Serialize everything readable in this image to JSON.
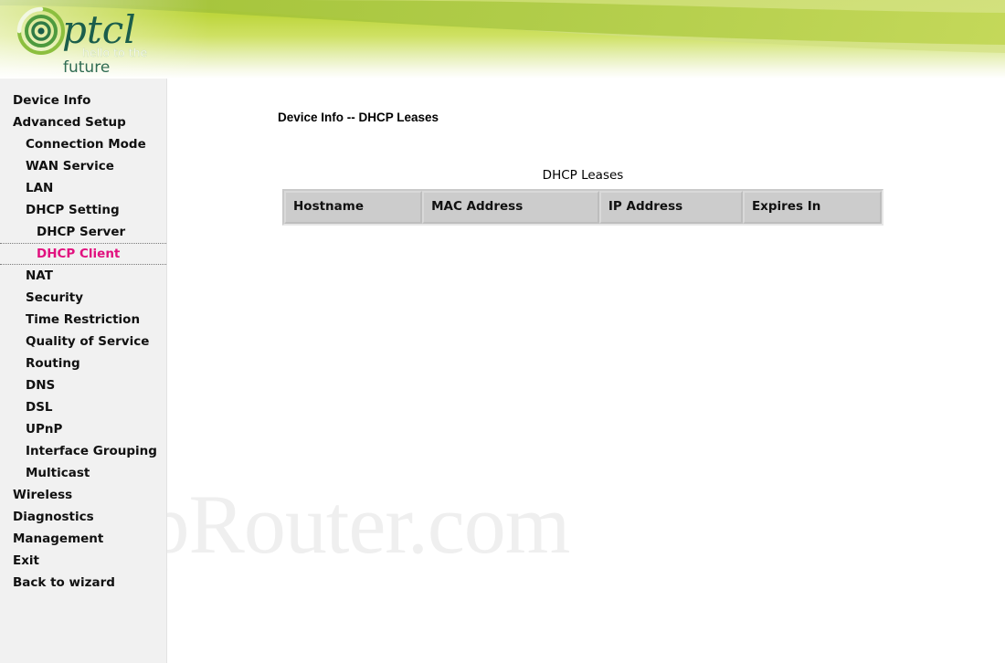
{
  "header": {
    "logo": {
      "brand": "ptcl",
      "tagline_line1": "hello to the",
      "tagline_line2": "future",
      "brand_color": "#1b5e4b",
      "tagline_color": "#ffffff",
      "future_color": "#2f6b52",
      "banner_top_color": "#b9d334",
      "banner_bottom_color": "#ffffff",
      "swoosh_color": "#a4c43a"
    }
  },
  "sidebar": {
    "items": [
      {
        "label": "Device Info",
        "level": 0,
        "selected": false
      },
      {
        "label": "Advanced Setup",
        "level": 0,
        "selected": false
      },
      {
        "label": "Connection Mode",
        "level": 1,
        "selected": false
      },
      {
        "label": "WAN Service",
        "level": 1,
        "selected": false
      },
      {
        "label": "LAN",
        "level": 1,
        "selected": false
      },
      {
        "label": "DHCP Setting",
        "level": 1,
        "selected": false
      },
      {
        "label": "DHCP Server",
        "level": 2,
        "selected": false
      },
      {
        "label": "DHCP Client",
        "level": 2,
        "selected": true
      },
      {
        "label": "NAT",
        "level": 1,
        "selected": false
      },
      {
        "label": "Security",
        "level": 1,
        "selected": false
      },
      {
        "label": "Time Restriction",
        "level": 1,
        "selected": false
      },
      {
        "label": "Quality of Service",
        "level": 1,
        "selected": false
      },
      {
        "label": "Routing",
        "level": 1,
        "selected": false
      },
      {
        "label": "DNS",
        "level": 1,
        "selected": false
      },
      {
        "label": "DSL",
        "level": 1,
        "selected": false
      },
      {
        "label": "UPnP",
        "level": 1,
        "selected": false
      },
      {
        "label": "Interface Grouping",
        "level": 1,
        "selected": false
      },
      {
        "label": "Multicast",
        "level": 1,
        "selected": false
      },
      {
        "label": "Wireless",
        "level": 0,
        "selected": false
      },
      {
        "label": "Diagnostics",
        "level": 0,
        "selected": false
      },
      {
        "label": "Management",
        "level": 0,
        "selected": false
      },
      {
        "label": "Exit",
        "level": 0,
        "selected": false
      },
      {
        "label": "Back to wizard",
        "level": 0,
        "selected": false
      }
    ],
    "selected_color": "#e1117f"
  },
  "main": {
    "page_title": "Device Info -- DHCP Leases",
    "table": {
      "caption": "DHCP Leases",
      "columns": [
        "Hostname",
        "MAC Address",
        "IP Address",
        "Expires In"
      ],
      "rows": [],
      "header_bg": "#cccccc"
    }
  },
  "watermark": {
    "text": "SetupRouter.com",
    "color": "#efefef"
  }
}
